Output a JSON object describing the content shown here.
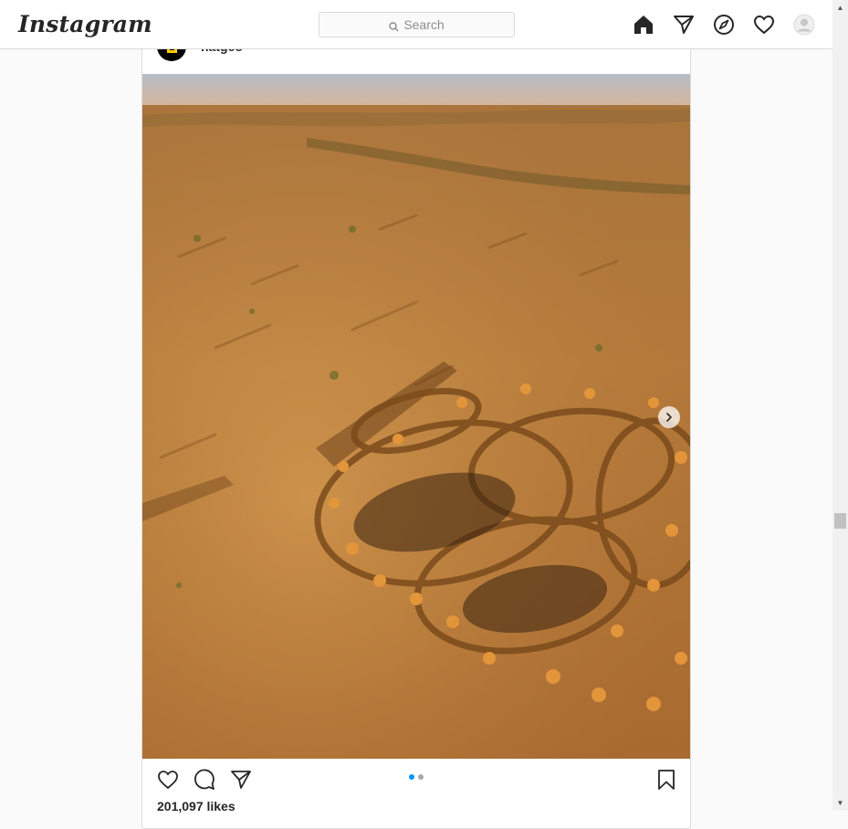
{
  "app": {
    "logo_text": "Instagram",
    "search_placeholder": "Search"
  },
  "nav": {
    "icons": [
      "home-icon",
      "direct-icon",
      "explore-icon",
      "activity-heart-icon",
      "profile-avatar-icon"
    ]
  },
  "post": {
    "username": "natgeo",
    "likes_text": "201,097 likes",
    "carousel": {
      "current_index": 1,
      "total": 2
    }
  },
  "colors": {
    "accent": "#0095f6",
    "border": "#dbdbdb",
    "background": "#fafafa",
    "brand_yellow": "#ffce00"
  }
}
